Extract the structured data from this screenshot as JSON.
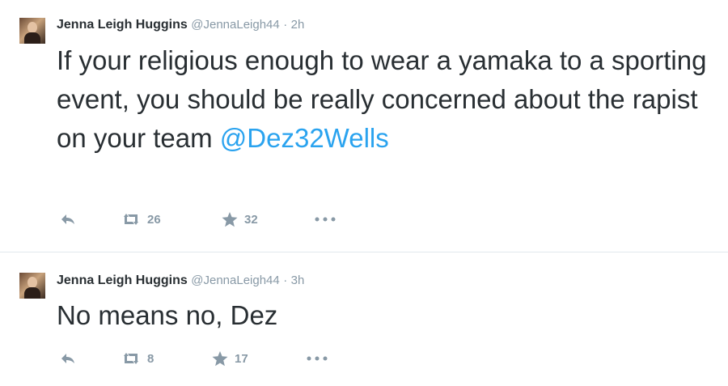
{
  "tweets": [
    {
      "author_name": "Jenna Leigh Huggins",
      "handle": "@JennaLeigh44",
      "separator": "·",
      "time": "2h",
      "text_before": "If your religious enough to wear a yamaka to a sporting event, you should be really concerned about the rapist on your team ",
      "mention": "@Dez32Wells",
      "retweet_count": "26",
      "favorite_count": "32"
    },
    {
      "author_name": "Jenna Leigh Huggins",
      "handle": "@JennaLeigh44",
      "separator": "·",
      "time": "3h",
      "text_before": "No means no, Dez",
      "mention": "",
      "retweet_count": "8",
      "favorite_count": "17"
    }
  ],
  "icons": {
    "reply": "reply-icon",
    "retweet": "retweet-icon",
    "favorite": "star-icon",
    "more": "more-icon"
  },
  "colors": {
    "text": "#292f33",
    "muted": "#8899a6",
    "link": "#2aa3ef",
    "divider": "#e1e8ed"
  }
}
